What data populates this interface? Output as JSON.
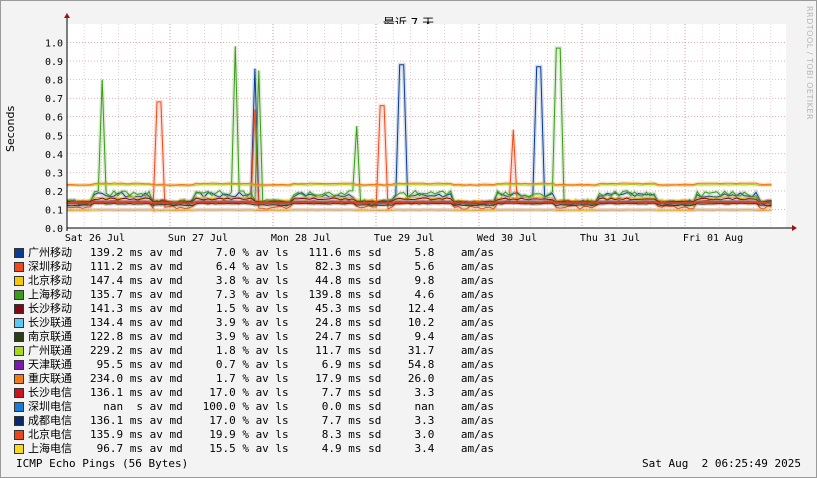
{
  "chart_data": {
    "type": "line",
    "title": "最近 7 天",
    "ylabel": "Seconds",
    "ylim": [
      0,
      1.1
    ],
    "yticks": [
      0.0,
      0.1,
      0.2,
      0.3,
      0.4,
      0.5,
      0.6,
      0.7,
      0.8,
      0.9,
      1.0
    ],
    "ytick_labels": [
      "0.0",
      "0.1",
      "0.2",
      "0.3",
      "0.4",
      "0.5",
      "0.6",
      "0.7",
      "0.8",
      "0.9",
      "1.0"
    ],
    "xtick_labels": [
      "Sat 26 Jul",
      "Sun 27 Jul",
      "Mon 28 Jul",
      "Tue 29 Jul",
      "Wed 30 Jul",
      "Thu 31 Jul",
      "Fri 01 Aug"
    ],
    "grid": true,
    "series": [
      {
        "name": "广州移动",
        "color": "#0a3d91",
        "median": 0.139,
        "loss_pct": 7.0,
        "sd": 0.1116,
        "spikes": [
          [
            0.37,
            0.86
          ],
          [
            0.66,
            0.88
          ],
          [
            0.93,
            0.87
          ]
        ]
      },
      {
        "name": "深圳移动",
        "color": "#ee4a1a",
        "median": 0.111,
        "loss_pct": 6.4,
        "sd": 0.0823,
        "spikes": [
          [
            0.18,
            0.68
          ],
          [
            0.37,
            0.64
          ],
          [
            0.62,
            0.66
          ],
          [
            0.88,
            0.53
          ]
        ]
      },
      {
        "name": "北京移动",
        "color": "#f5c900",
        "median": 0.147,
        "loss_pct": 3.8,
        "sd": 0.0448,
        "spikes": []
      },
      {
        "name": "上海移动",
        "color": "#3c9b1a",
        "median": 0.136,
        "loss_pct": 7.3,
        "sd": 0.1398,
        "spikes": [
          [
            0.07,
            0.8
          ],
          [
            0.33,
            0.98
          ],
          [
            0.38,
            0.85
          ],
          [
            0.57,
            0.55
          ],
          [
            0.97,
            0.97
          ]
        ]
      },
      {
        "name": "长沙移动",
        "color": "#7a0a14",
        "median": 0.141,
        "loss_pct": 1.5,
        "sd": 0.0453,
        "spikes": []
      },
      {
        "name": "长沙联通",
        "color": "#5ec8f2",
        "median": 0.134,
        "loss_pct": 3.9,
        "sd": 0.0248,
        "spikes": []
      },
      {
        "name": "南京联通",
        "color": "#2f3d12",
        "median": 0.123,
        "loss_pct": 3.9,
        "sd": 0.0247,
        "spikes": []
      },
      {
        "name": "广州联通",
        "color": "#a8d81a",
        "median": 0.229,
        "loss_pct": 1.8,
        "sd": 0.0117,
        "spikes": []
      },
      {
        "name": "天津联通",
        "color": "#7b1aa8",
        "median": 0.0955,
        "loss_pct": 0.7,
        "sd": 0.0069,
        "spikes": []
      },
      {
        "name": "重庆联通",
        "color": "#f07a1a",
        "median": 0.234,
        "loss_pct": 1.7,
        "sd": 0.0179,
        "spikes": []
      },
      {
        "name": "长沙电信",
        "color": "#c8141a",
        "median": 0.136,
        "loss_pct": 17.0,
        "sd": 0.0077,
        "spikes": []
      },
      {
        "name": "深圳电信",
        "color": "#1a7ad8",
        "median": null,
        "loss_pct": 100.0,
        "sd": 0.0,
        "spikes": []
      },
      {
        "name": "成都电信",
        "color": "#0a2a6a",
        "median": 0.136,
        "loss_pct": 17.0,
        "sd": 0.0077,
        "spikes": []
      },
      {
        "name": "北京电信",
        "color": "#e8481a",
        "median": 0.136,
        "loss_pct": 19.9,
        "sd": 0.0083,
        "spikes": []
      },
      {
        "name": "上海电信",
        "color": "#f8d81a",
        "median": 0.0967,
        "loss_pct": 15.5,
        "sd": 0.0049,
        "spikes": []
      }
    ]
  },
  "legend": [
    {
      "name": "广州移动",
      "color": "#0a3d91",
      "stats": "139.2 ms av md     7.0 % av ls   111.6 ms sd     5.8    am/as"
    },
    {
      "name": "深圳移动",
      "color": "#ee4a1a",
      "stats": "111.2 ms av md     6.4 % av ls    82.3 ms sd     5.6    am/as"
    },
    {
      "name": "北京移动",
      "color": "#f5c900",
      "stats": "147.4 ms av md     3.8 % av ls    44.8 ms sd     9.8    am/as"
    },
    {
      "name": "上海移动",
      "color": "#3c9b1a",
      "stats": "135.7 ms av md     7.3 % av ls   139.8 ms sd     4.6    am/as"
    },
    {
      "name": "长沙移动",
      "color": "#7a0a14",
      "stats": "141.3 ms av md     1.5 % av ls    45.3 ms sd    12.4    am/as"
    },
    {
      "name": "长沙联通",
      "color": "#5ec8f2",
      "stats": "134.4 ms av md     3.9 % av ls    24.8 ms sd    10.2    am/as"
    },
    {
      "name": "南京联通",
      "color": "#2f3d12",
      "stats": "122.8 ms av md     3.9 % av ls    24.7 ms sd     9.4    am/as"
    },
    {
      "name": "广州联通",
      "color": "#a8d81a",
      "stats": "229.2 ms av md     1.8 % av ls    11.7 ms sd    31.7    am/as"
    },
    {
      "name": "天津联通",
      "color": "#7b1aa8",
      "stats": " 95.5 ms av md     0.7 % av ls     6.9 ms sd    54.8    am/as"
    },
    {
      "name": "重庆联通",
      "color": "#f07a1a",
      "stats": "234.0 ms av md     1.7 % av ls    17.9 ms sd    26.0    am/as"
    },
    {
      "name": "长沙电信",
      "color": "#c8141a",
      "stats": "136.1 ms av md    17.0 % av ls     7.7 ms sd     3.3    am/as"
    },
    {
      "name": "深圳电信",
      "color": "#1a7ad8",
      "stats": "  nan  s av md   100.0 % av ls     0.0 ms sd     nan    am/as"
    },
    {
      "name": "成都电信",
      "color": "#0a2a6a",
      "stats": "136.1 ms av md    17.0 % av ls     7.7 ms sd     3.3    am/as"
    },
    {
      "name": "北京电信",
      "color": "#e8481a",
      "stats": "135.9 ms av md    19.9 % av ls     8.3 ms sd     3.0    am/as"
    },
    {
      "name": "上海电信",
      "color": "#f8d81a",
      "stats": " 96.7 ms av md    15.5 % av ls     4.9 ms sd     3.4    am/as"
    }
  ],
  "footer": {
    "left": "ICMP Echo Pings (56 Bytes)",
    "right": "Sat Aug  2 06:25:49 2025"
  },
  "watermark": "RRDTOOL / TOBI OETIKER"
}
